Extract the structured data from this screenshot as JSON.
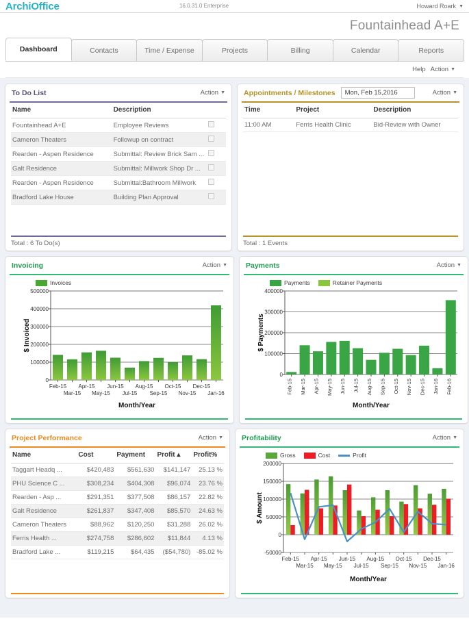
{
  "topbar": {
    "logo_archi": "Archi",
    "logo_office": "Office",
    "version": "16.0.31.0 Enterprise",
    "user": "Howard Roark",
    "caret": "▼"
  },
  "company_title": "Fountainhead A+E",
  "tabs": [
    {
      "label": "Dashboard",
      "active": true
    },
    {
      "label": "Contacts",
      "active": false
    },
    {
      "label": "Time / Expense",
      "active": false
    },
    {
      "label": "Projects",
      "active": false
    },
    {
      "label": "Billing",
      "active": false
    },
    {
      "label": "Calendar",
      "active": false
    },
    {
      "label": "Reports",
      "active": false
    }
  ],
  "helprow": {
    "help": "Help",
    "action": "Action",
    "caret": "▼"
  },
  "action_label": "Action",
  "action_caret": "▼",
  "todo": {
    "title": "To Do List",
    "columns": [
      "Name",
      "Description",
      ""
    ],
    "rows": [
      {
        "name": "Fountainhead A+E",
        "description": "Employee Reviews"
      },
      {
        "name": "Cameron Theaters",
        "description": "Followup on contract"
      },
      {
        "name": "Rearden - Aspen Residence",
        "description": "Submittal: Review Brick Sam ..."
      },
      {
        "name": "Galt Residence",
        "description": "Submittal: Millwork Shop Dr ..."
      },
      {
        "name": "Rearden - Aspen Residence",
        "description": "Submittal:Bathroom Millwork"
      },
      {
        "name": "Bradford Lake House",
        "description": "Building Plan Approval"
      }
    ],
    "total": "Total :  6 To Do(s)"
  },
  "appointments": {
    "title": "Appointments / Milestones",
    "date_value": "Mon, Feb 15,2016",
    "columns": [
      "Time",
      "Project",
      "Description"
    ],
    "rows": [
      {
        "time": "11:00 AM",
        "project": "Ferris Health Clinic",
        "description": "Bid-Review with Owner"
      }
    ],
    "total": "Total :  1 Events"
  },
  "invoicing": {
    "title": "Invoicing"
  },
  "payments": {
    "title": "Payments"
  },
  "performance": {
    "title": "Project Performance",
    "columns": [
      "Name",
      "Cost",
      "Payment",
      "Profit ▴",
      "Profit%"
    ],
    "rows": [
      {
        "name": "Taggart Headq ...",
        "cost": "$420,483",
        "payment": "$561,630",
        "profit": "$141,147",
        "profit_pct": "25.13 %"
      },
      {
        "name": "PHU Science C ...",
        "cost": "$308,234",
        "payment": "$404,308",
        "profit": "$96,074",
        "profit_pct": "23.76 %"
      },
      {
        "name": "Rearden - Asp ...",
        "cost": "$291,351",
        "payment": "$377,508",
        "profit": "$86,157",
        "profit_pct": "22.82 %"
      },
      {
        "name": "Galt Residence",
        "cost": "$261,837",
        "payment": "$347,408",
        "profit": "$85,570",
        "profit_pct": "24.63 %"
      },
      {
        "name": "Cameron Theaters",
        "cost": "$88,962",
        "payment": "$120,250",
        "profit": "$31,288",
        "profit_pct": "26.02 %"
      },
      {
        "name": "Ferris Health ...",
        "cost": "$274,758",
        "payment": "$286,602",
        "profit": "$11,844",
        "profit_pct": "4.13 %"
      },
      {
        "name": "Bradford Lake ...",
        "cost": "$119,215",
        "payment": "$64,435",
        "profit": "($54,780)",
        "profit_pct": "-85.02 %"
      }
    ]
  },
  "profitability": {
    "title": "Profitability"
  },
  "colors": {
    "logo": "#27b2c6",
    "purple": "#6f6a96",
    "gold": "#b59328",
    "green": "#2fba73",
    "orange": "#f0871f",
    "bar_green": "#4aa832",
    "bar_green_light": "#8cc63f",
    "payments_green": "#3aa545",
    "retainer_green": "#8cc63f",
    "cost_red": "#ee1c25",
    "profit_blue": "#4a90c4",
    "board_bg": "#eef2f7"
  },
  "chart_data": [
    {
      "type": "bar",
      "id": "invoicing",
      "title": "Invoicing",
      "xlabel": "Month/Year",
      "ylabel": "$ Invoiced",
      "ylim": [
        0,
        500000
      ],
      "yticks": [
        0,
        100000,
        200000,
        300000,
        400000,
        500000
      ],
      "grid": true,
      "legend": [
        "Invoices"
      ],
      "legend_position": "top-left",
      "categories": [
        "Feb-15",
        "Mar-15",
        "Apr-15",
        "May-15",
        "Jun-15",
        "Jul-15",
        "Aug-15",
        "Sep-15",
        "Oct-15",
        "Nov-15",
        "Dec-15",
        "Jan-16"
      ],
      "series": [
        {
          "name": "Invoices",
          "values": [
            141000,
            116000,
            155000,
            164000,
            125000,
            69000,
            106000,
            124000,
            100000,
            138000,
            117000,
            419000
          ]
        }
      ]
    },
    {
      "type": "bar",
      "id": "payments",
      "title": "Payments",
      "xlabel": "Month/Year",
      "ylabel": "$ Payments",
      "ylim": [
        0,
        400000
      ],
      "yticks": [
        0,
        100000,
        200000,
        300000,
        400000
      ],
      "grid": true,
      "legend": [
        "Payments",
        "Retainer Payments"
      ],
      "legend_position": "top-left",
      "categories": [
        "Feb-15",
        "Mar-15",
        "Apr-15",
        "May-15",
        "Jun-15",
        "Jul-15",
        "Aug-15",
        "Sep-15",
        "Oct-15",
        "Nov-15",
        "Dec-15",
        "Jan-16",
        "Feb-16"
      ],
      "series": [
        {
          "name": "Payments",
          "values": [
            12000,
            140000,
            111000,
            156000,
            161000,
            126000,
            70000,
            104000,
            123000,
            93000,
            138000,
            30000,
            356000
          ]
        },
        {
          "name": "Retainer Payments",
          "values": [
            0,
            0,
            0,
            0,
            0,
            0,
            0,
            0,
            0,
            0,
            0,
            0,
            0
          ]
        }
      ]
    },
    {
      "type": "bar",
      "id": "profitability",
      "title": "Profitability",
      "xlabel": "Month/Year",
      "ylabel": "$ Amount",
      "ylim": [
        -50000,
        200000
      ],
      "yticks": [
        -50000,
        0,
        50000,
        100000,
        150000,
        200000
      ],
      "grid": true,
      "legend": [
        "Gross",
        "Cost",
        "Profit"
      ],
      "legend_position": "top-left",
      "categories": [
        "Feb-15",
        "Mar-15",
        "Apr-15",
        "May-15",
        "Jun-15",
        "Jul-15",
        "Aug-15",
        "Sep-15",
        "Oct-15",
        "Nov-15",
        "Dec-15",
        "Jan-16"
      ],
      "series": [
        {
          "name": "Gross",
          "type": "bar",
          "values": [
            142000,
            116000,
            155000,
            164000,
            125000,
            68000,
            105000,
            125000,
            93000,
            139000,
            115000,
            129000
          ]
        },
        {
          "name": "Cost",
          "type": "bar",
          "values": [
            27000,
            126000,
            74000,
            82000,
            141000,
            52000,
            70000,
            52000,
            86000,
            74000,
            84000,
            101000
          ]
        },
        {
          "name": "Profit",
          "type": "line",
          "values": [
            117000,
            -13000,
            78000,
            83000,
            -19000,
            16000,
            35000,
            73000,
            7000,
            65000,
            31000,
            28000
          ]
        }
      ]
    }
  ]
}
